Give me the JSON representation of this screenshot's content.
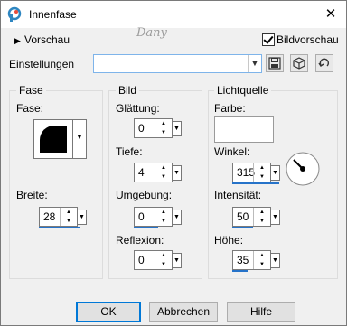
{
  "window": {
    "title": "Innenfase",
    "close_glyph": "✕"
  },
  "top": {
    "preview_label": "Vorschau",
    "image_preview_label": "Bildvorschau",
    "image_preview_checked": true,
    "settings_label": "Einstellungen",
    "settings_value": "",
    "watermark": "Dany"
  },
  "fase": {
    "group_title": "Fase",
    "fase_label": "Fase:",
    "width_label": "Breite:",
    "width_value": "28"
  },
  "bild": {
    "group_title": "Bild",
    "smoothing_label": "Glättung:",
    "smoothing_value": "0",
    "depth_label": "Tiefe:",
    "depth_value": "4",
    "ambient_label": "Umgebung:",
    "ambient_value": "0",
    "reflection_label": "Reflexion:",
    "reflection_value": "0"
  },
  "light": {
    "group_title": "Lichtquelle",
    "color_label": "Farbe:",
    "color_value": "#ffffff",
    "angle_label": "Winkel:",
    "angle_value": "315",
    "intensity_label": "Intensität:",
    "intensity_value": "50",
    "height_label": "Höhe:",
    "height_value": "35"
  },
  "buttons": {
    "ok": "OK",
    "cancel": "Abbrechen",
    "help": "Hilfe"
  }
}
